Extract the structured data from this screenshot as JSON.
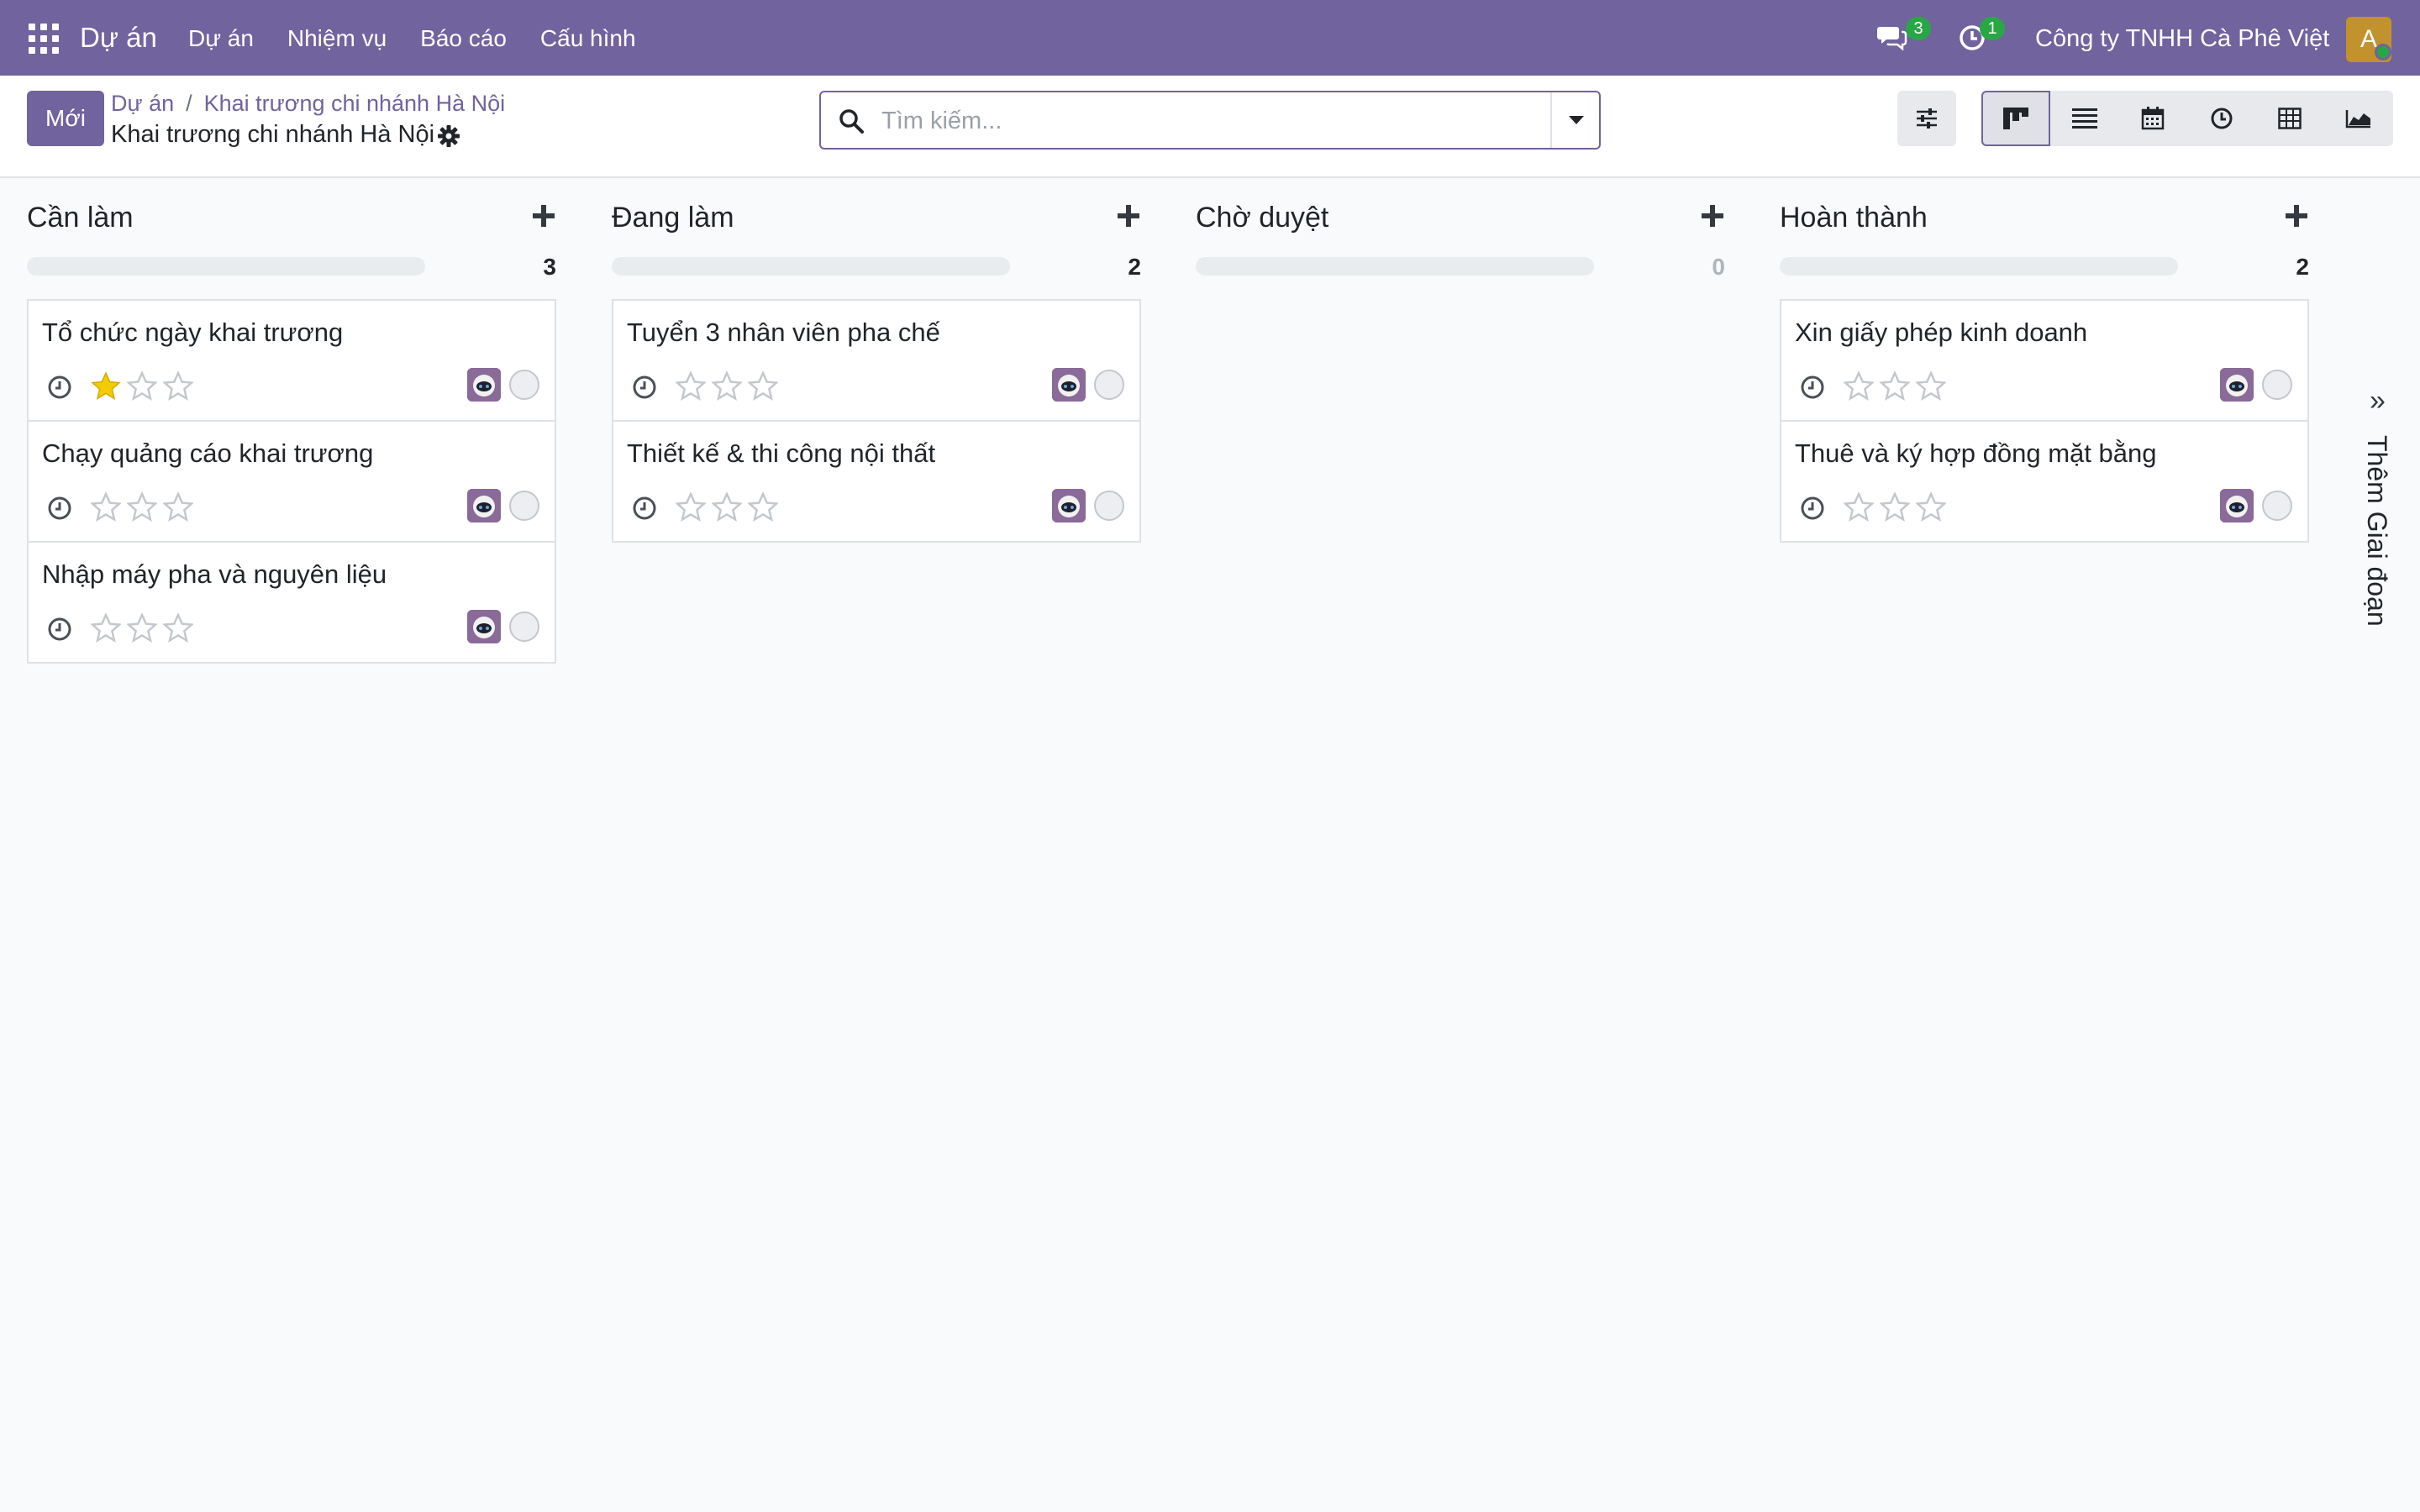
{
  "navbar": {
    "brand": "Dự án",
    "menu": [
      "Dự án",
      "Nhiệm vụ",
      "Báo cáo",
      "Cấu hình"
    ],
    "chat_count": "3",
    "activity_count": "1",
    "company": "Công ty TNHH Cà Phê Việt",
    "user_initial": "A"
  },
  "control_panel": {
    "new_label": "Mới",
    "breadcrumb": [
      "Dự án",
      "Khai trương chi nhánh Hà Nội"
    ],
    "breadcrumb_sep": "/",
    "current_title": "Khai trương chi nhánh Hà Nội",
    "search_placeholder": "Tìm kiếm...",
    "active_view": "kanban"
  },
  "columns": [
    {
      "title": "Cần làm",
      "count": "3",
      "cards": [
        {
          "title": "Tổ chức ngày khai trương",
          "stars": 1
        },
        {
          "title": "Chạy quảng cáo khai trương",
          "stars": 0
        },
        {
          "title": "Nhập máy pha và nguyên liệu",
          "stars": 0
        }
      ]
    },
    {
      "title": "Đang làm",
      "count": "2",
      "cards": [
        {
          "title": "Tuyển 3 nhân viên pha chế",
          "stars": 0
        },
        {
          "title": "Thiết kế & thi công nội thất",
          "stars": 0
        }
      ]
    },
    {
      "title": "Chờ duyệt",
      "count": "0",
      "cards": []
    },
    {
      "title": "Hoàn thành",
      "count": "2",
      "cards": [
        {
          "title": "Xin giấy phép kinh doanh",
          "stars": 0
        },
        {
          "title": "Thuê và ký hợp đồng mặt bằng",
          "stars": 0
        }
      ]
    }
  ],
  "add_stage": {
    "chevrons": "»",
    "label": "Thêm Giai đoạn"
  },
  "colors": {
    "brand": "#71639e",
    "star_filled": "#f3cc00",
    "star_empty": "#c4c8cd",
    "badge": "#28a745"
  }
}
